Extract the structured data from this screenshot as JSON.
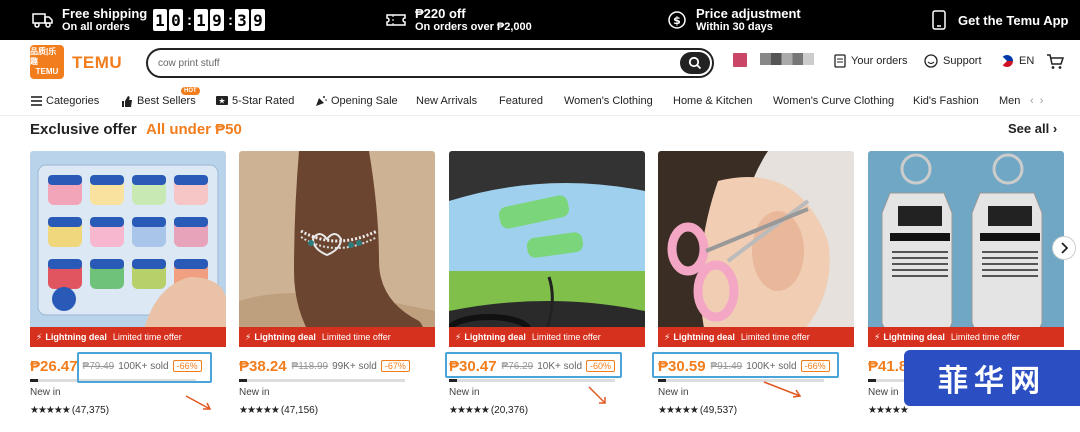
{
  "promo": {
    "free_shipping_title": "Free shipping",
    "free_shipping_sub": "On all orders",
    "countdown": [
      "1",
      "0",
      ":",
      "1",
      "9",
      ":",
      "3",
      "9"
    ],
    "off_title": "₱220 off",
    "off_sub": "On orders over ₱2,000",
    "price_adj_title": "Price adjustment",
    "price_adj_sub": "Within 30 days",
    "app_title": "Get the Temu App"
  },
  "header": {
    "logo_small_top": "品质|乐趣",
    "logo_small_bottom": "TEMU",
    "logo_text": "TEMU",
    "search_value": "cow print stuff",
    "your_orders": "Your orders",
    "support": "Support",
    "lang": "EN"
  },
  "categories": {
    "items": [
      "Categories",
      "Best Sellers",
      "5-Star Rated",
      "Opening Sale",
      "New Arrivals",
      "Featured",
      "Women's Clothing",
      "Home & Kitchen",
      "Women's Curve Clothing",
      "Kid's Fashion",
      "Men"
    ],
    "hot_badge": "HOT"
  },
  "section": {
    "title": "Exclusive offer",
    "subtitle": "All under ₱50",
    "see_all": "See all"
  },
  "deal": {
    "lightning": "Lightning",
    "deal": "deal",
    "limited": "Limited time offer"
  },
  "products": [
    {
      "price": "₱26.47",
      "old": "₱79.49",
      "sold": "100K+ sold",
      "discount": "-66%",
      "new_in": "New in",
      "stars": "★★★★★",
      "reviews": "(47,375)",
      "progress": 0.05
    },
    {
      "price": "₱38.24",
      "old": "₱118.99",
      "sold": "99K+ sold",
      "discount": "-67%",
      "new_in": "New in",
      "stars": "★★★★★",
      "reviews": "(47,156)",
      "progress": 0.05
    },
    {
      "price": "₱30.47",
      "old": "₱76.29",
      "sold": "10K+ sold",
      "discount": "-60%",
      "new_in": "New in",
      "stars": "★★★★★",
      "reviews": "(20,376)",
      "progress": 0.05
    },
    {
      "price": "₱30.59",
      "old": "₱91.49",
      "sold": "100K+ sold",
      "discount": "-66%",
      "new_in": "New in",
      "stars": "★★★★★",
      "reviews": "(49,537)",
      "progress": 0.05
    },
    {
      "price": "₱41.84",
      "old": "",
      "sold": "",
      "discount": "",
      "new_in": "New in",
      "stars": "★★★★★",
      "reviews": "",
      "progress": 0.05
    }
  ],
  "watermark": "菲华网",
  "colors": {
    "brand": "#f27d1c",
    "deal_red": "#d6301f",
    "highlight": "#4aa3d9"
  }
}
